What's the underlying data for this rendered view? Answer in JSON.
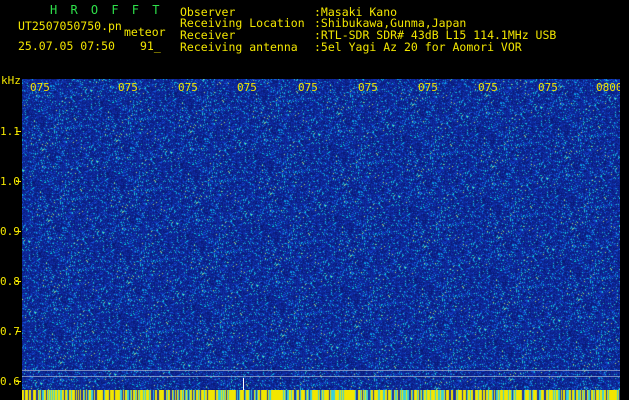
{
  "header": {
    "brand": "H R O F F T",
    "filename": "UT2507050750.pn",
    "type_label": "meteor",
    "datetime": "25.07.05 07:50",
    "count": "91_",
    "fields": [
      {
        "label": "Observer",
        "value": ":Masaki Kano"
      },
      {
        "label": "Receiving Location",
        "value": ":Shibukawa,Gunma,Japan"
      },
      {
        "label": "Receiver",
        "value": ":RTL-SDR SDR# 43dB L15 114.1MHz USB"
      },
      {
        "label": "Receiving antenna",
        "value": ":5el Yagi Az 20 for Aomori VOR"
      }
    ]
  },
  "axes": {
    "y_unit": "kHz",
    "y_ticks": [
      "1.1",
      "1.0",
      "0.9",
      "0.8",
      "0.7",
      "0.6"
    ],
    "x_ticks": [
      "075",
      "075",
      "075",
      "075",
      "075",
      "075",
      "075",
      "075",
      "075",
      "0800"
    ]
  },
  "colors": {
    "background": "#000000",
    "brand": "#2ee04a",
    "text": "#f2e600",
    "plot_bg": "#0b2696"
  }
}
